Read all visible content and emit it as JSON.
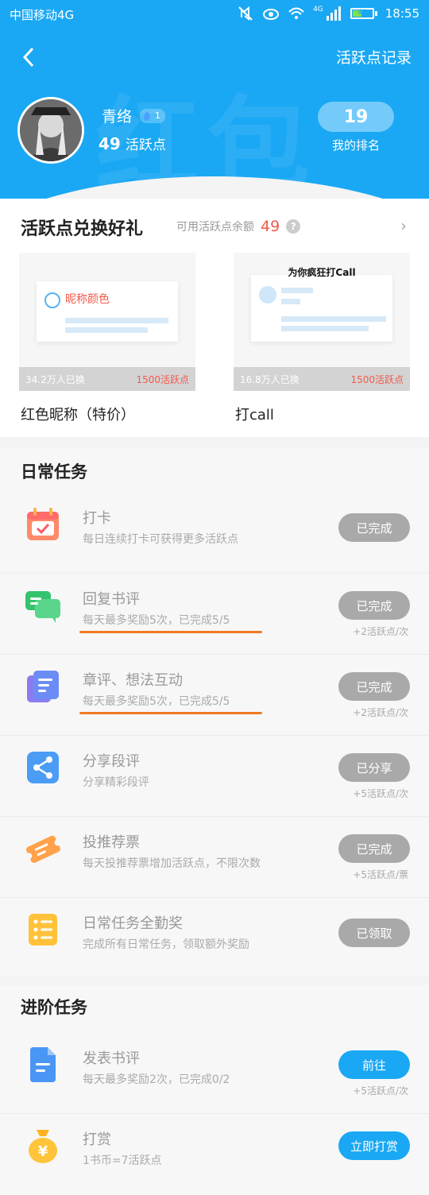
{
  "status_bar": {
    "carrier": "中国移动4G",
    "network": "4G",
    "battery": "44",
    "time": "18:55"
  },
  "header": {
    "record_link": "活跃点记录",
    "watermark": "红包",
    "user": {
      "nickname": "青络",
      "level": "1",
      "points_value": "49",
      "points_label": "活跃点"
    },
    "rank": {
      "value": "19",
      "label": "我的排名"
    }
  },
  "exchange": {
    "title": "活跃点兑换好礼",
    "balance_label": "可用活跃点余额",
    "balance_value": "49",
    "help": "?",
    "more": "›",
    "gifts": [
      {
        "name": "红色昵称（特价）",
        "count": "34.2万人已换",
        "cost": "1500活跃点",
        "preview_title": "昵称颜色"
      },
      {
        "name": "打call",
        "count": "16.8万人已换",
        "cost": "1500活跃点",
        "preview_title": "为你疯狂打Call"
      }
    ]
  },
  "daily": {
    "title": "日常任务",
    "tasks": [
      {
        "title": "打卡",
        "desc": "每日连续打卡可获得更多活跃点",
        "button": "已完成",
        "reward": ""
      },
      {
        "title": "回复书评",
        "desc": "每天最多奖励5次，已完成5/5",
        "button": "已完成",
        "reward": "+2活跃点/次"
      },
      {
        "title": "章评、想法互动",
        "desc": "每天最多奖励5次，已完成5/5",
        "button": "已完成",
        "reward": "+2活跃点/次"
      },
      {
        "title": "分享段评",
        "desc": "分享精彩段评",
        "button": "已分享",
        "reward": "+5活跃点/次"
      },
      {
        "title": "投推荐票",
        "desc": "每天投推荐票增加活跃点，不限次数",
        "button": "已完成",
        "reward": "+5活跃点/票"
      },
      {
        "title": "日常任务全勤奖",
        "desc": "完成所有日常任务，领取额外奖励",
        "button": "已领取",
        "reward": ""
      }
    ]
  },
  "advanced": {
    "title": "进阶任务",
    "tasks": [
      {
        "title": "发表书评",
        "desc": "每天最多奖励2次，已完成0/2",
        "button": "前往",
        "reward": "+5活跃点/次"
      },
      {
        "title": "打赏",
        "desc": "1书币=7活跃点",
        "button": "立即打赏",
        "reward": ""
      }
    ]
  },
  "colors": {
    "primary": "#1aa8f4",
    "accent_red": "#f35a4a",
    "done_grey": "#a9a9a9",
    "underline_orange": "#f07a22"
  }
}
